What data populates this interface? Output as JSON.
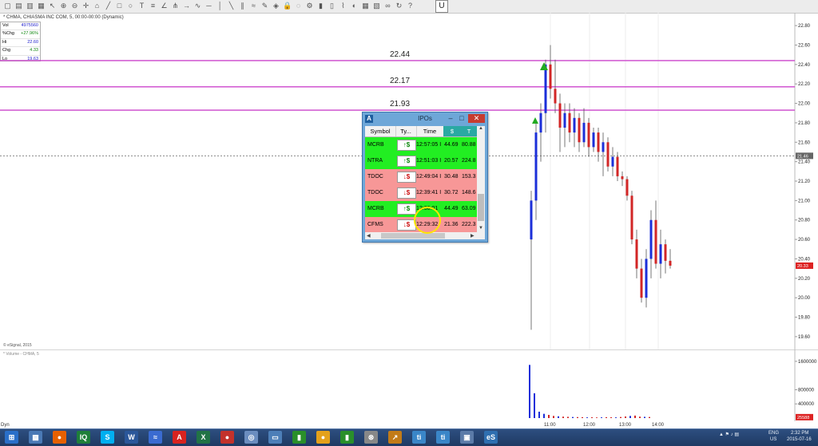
{
  "toolbar": {
    "icons": [
      "file-icon",
      "open-icon",
      "save-icon",
      "print-icon",
      "cursor-icon",
      "zoom-in-icon",
      "zoom-out-icon",
      "crosshair-icon",
      "home-icon",
      "line-icon",
      "rectangle-icon",
      "ellipse-icon",
      "text-icon",
      "fibonacci-icon",
      "gann-icon",
      "pitchfork-icon",
      "arrow-icon",
      "cycle-icon",
      "horizontal-line-icon",
      "vertical-line-icon",
      "trendline-icon",
      "channel-icon",
      "regression-icon",
      "erase-icon",
      "magnet-icon",
      "lock-icon",
      "hide-icon",
      "properties-icon",
      "bar-style-icon",
      "candle-icon",
      "line-style-icon",
      "color-icon",
      "layout-icon",
      "template-icon",
      "link-icon",
      "refresh-icon",
      "help-icon"
    ],
    "u_label": "U"
  },
  "chart": {
    "title": "* CHMA, CHIASMA INC COM, 5, 00:00-00:00 (Dynamic)",
    "info": [
      {
        "key": "Vol",
        "value": "4975560"
      },
      {
        "key": "%Chg",
        "value": "+27.96%",
        "color": "green"
      },
      {
        "key": "Hi",
        "value": "22.60"
      },
      {
        "key": "Chg",
        "value": "4.33",
        "color": "green"
      },
      {
        "key": "Lo",
        "value": "19.63"
      }
    ],
    "levels": [
      "22.44",
      "22.17",
      "21.93"
    ],
    "esignal": "© eSignal, 2015",
    "volume_label": "* Volume - CHMA, 5",
    "dyn": "Dyn",
    "price_badge": "21.46",
    "last_badge": "20.33",
    "vol_badge": "25588"
  },
  "chart_data": [
    {
      "type": "candlestick",
      "yaxis_ticks": [
        "22.80",
        "22.60",
        "22.40",
        "22.20",
        "22.00",
        "21.80",
        "21.60",
        "21.40",
        "21.20",
        "21.00",
        "20.80",
        "20.60",
        "20.40",
        "20.20",
        "20.00",
        "19.80",
        "19.60"
      ],
      "ylim": [
        19.55,
        22.85
      ],
      "xaxis_ticks": [
        "11:00",
        "12:00",
        "13:00",
        "14:00"
      ],
      "horizontal_lines": [
        22.44,
        22.17,
        21.93
      ],
      "dotted_line": 21.46,
      "candles": [
        {
          "o": 20.6,
          "h": 21.1,
          "l": 19.67,
          "c": 21.0
        },
        {
          "o": 21.0,
          "h": 21.8,
          "l": 20.8,
          "c": 21.7
        },
        {
          "o": 21.7,
          "h": 22.0,
          "l": 21.4,
          "c": 21.9
        },
        {
          "o": 21.9,
          "h": 22.45,
          "l": 21.7,
          "c": 22.4
        },
        {
          "o": 22.4,
          "h": 22.6,
          "l": 22.05,
          "c": 22.15
        },
        {
          "o": 22.15,
          "h": 22.45,
          "l": 21.9,
          "c": 22.0
        },
        {
          "o": 22.0,
          "h": 22.1,
          "l": 21.5,
          "c": 21.75
        },
        {
          "o": 21.75,
          "h": 22.0,
          "l": 21.55,
          "c": 21.9
        },
        {
          "o": 21.9,
          "h": 22.0,
          "l": 21.6,
          "c": 21.7
        },
        {
          "o": 21.7,
          "h": 21.95,
          "l": 21.55,
          "c": 21.85
        },
        {
          "o": 21.85,
          "h": 21.9,
          "l": 21.5,
          "c": 21.6
        },
        {
          "o": 21.6,
          "h": 21.95,
          "l": 21.55,
          "c": 21.8
        },
        {
          "o": 21.8,
          "h": 21.85,
          "l": 21.45,
          "c": 21.55
        },
        {
          "o": 21.55,
          "h": 21.75,
          "l": 21.5,
          "c": 21.7
        },
        {
          "o": 21.7,
          "h": 21.75,
          "l": 21.4,
          "c": 21.5
        },
        {
          "o": 21.5,
          "h": 21.7,
          "l": 21.25,
          "c": 21.6
        },
        {
          "o": 21.6,
          "h": 21.65,
          "l": 21.3,
          "c": 21.35
        },
        {
          "o": 21.35,
          "h": 21.55,
          "l": 21.25,
          "c": 21.45
        },
        {
          "o": 21.45,
          "h": 21.5,
          "l": 21.2,
          "c": 21.25
        },
        {
          "o": 21.25,
          "h": 21.3,
          "l": 21.15,
          "c": 21.22
        },
        {
          "o": 21.22,
          "h": 21.25,
          "l": 21.0,
          "c": 21.05
        },
        {
          "o": 21.05,
          "h": 21.1,
          "l": 20.55,
          "c": 20.6
        },
        {
          "o": 20.6,
          "h": 20.7,
          "l": 20.2,
          "c": 20.3
        },
        {
          "o": 20.3,
          "h": 20.4,
          "l": 19.95,
          "c": 20.0
        },
        {
          "o": 20.0,
          "h": 20.5,
          "l": 19.9,
          "c": 20.4
        },
        {
          "o": 20.4,
          "h": 20.9,
          "l": 20.2,
          "c": 20.8
        },
        {
          "o": 20.8,
          "h": 21.0,
          "l": 20.3,
          "c": 20.35
        },
        {
          "o": 20.35,
          "h": 20.7,
          "l": 20.2,
          "c": 20.55
        },
        {
          "o": 20.55,
          "h": 20.6,
          "l": 20.25,
          "c": 20.38
        },
        {
          "o": 20.38,
          "h": 20.5,
          "l": 20.3,
          "c": 20.33
        }
      ]
    },
    {
      "type": "bar",
      "yaxis_ticks": [
        "1600000",
        "800000",
        "400000"
      ],
      "values": [
        1500000,
        700000,
        180000,
        120000,
        90000,
        60000,
        50000,
        40000,
        35000,
        30000,
        28000,
        25000,
        20000,
        22000,
        18000,
        20000,
        25000,
        22000,
        20000,
        30000,
        45000,
        60000,
        70000,
        40000,
        35000,
        30000
      ]
    }
  ],
  "ipo_window": {
    "title": "IPOs",
    "app_letter": "A",
    "columns": [
      "Symbol",
      "Ty...",
      "Time",
      "$",
      "T"
    ],
    "rows": [
      {
        "symbol": "MCRB",
        "dir": "up",
        "badge": "↑$",
        "time": "12:57:05 I",
        "price": "44.69",
        "t": "80.88"
      },
      {
        "symbol": "NTRA",
        "dir": "up",
        "badge": "↑$",
        "time": "12:51:03 I",
        "price": "20.57",
        "t": "224.8"
      },
      {
        "symbol": "TDOC",
        "dir": "down",
        "badge": "↓$",
        "time": "12:49:04 I",
        "price": "30.48",
        "t": "153.3"
      },
      {
        "symbol": "TDOC",
        "dir": "down",
        "badge": "↓$",
        "time": "12:39:41 I",
        "price": "30.72",
        "t": "148.6"
      },
      {
        "symbol": "MCRB",
        "dir": "up",
        "badge": "↑$",
        "time": "12:36:01",
        "price": "44.49",
        "t": "63.09"
      },
      {
        "symbol": "CFMS",
        "dir": "down",
        "badge": "↓$",
        "time": "12:29:32",
        "price": "21.36",
        "t": "222.3"
      }
    ]
  },
  "taskbar": {
    "apps": [
      {
        "name": "start-button",
        "label": "⊞",
        "color": "#2a6fc9"
      },
      {
        "name": "file-explorer-icon",
        "label": "▦",
        "color": "#4a79b5"
      },
      {
        "name": "firefox-icon",
        "label": "●",
        "color": "#e66000"
      },
      {
        "name": "iq-icon",
        "label": "IQ",
        "color": "#1e7f3a"
      },
      {
        "name": "skype-icon",
        "label": "S",
        "color": "#00aff0"
      },
      {
        "name": "word-icon",
        "label": "W",
        "color": "#2b579a"
      },
      {
        "name": "stock-chart-icon",
        "label": "≈",
        "color": "#3a6bd1"
      },
      {
        "name": "pdf-icon",
        "label": "A",
        "color": "#d8231f"
      },
      {
        "name": "excel-icon",
        "label": "X",
        "color": "#217346"
      },
      {
        "name": "browser-icon",
        "label": "●",
        "color": "#c3322b"
      },
      {
        "name": "media-icon",
        "label": "◎",
        "color": "#6b8dbf"
      },
      {
        "name": "monitor-icon",
        "label": "▭",
        "color": "#4d7fb8"
      },
      {
        "name": "trading-icon",
        "label": "▮",
        "color": "#2a8f2a"
      },
      {
        "name": "chrome-icon",
        "label": "●",
        "color": "#e4a11b"
      },
      {
        "name": "trading-icon-2",
        "label": "▮",
        "color": "#2a8f2a"
      },
      {
        "name": "steering-icon",
        "label": "⊗",
        "color": "#888888"
      },
      {
        "name": "arrow-app-icon",
        "label": "↗",
        "color": "#c27b18"
      },
      {
        "name": "ti-icon",
        "label": "ti",
        "color": "#3a86c8"
      },
      {
        "name": "ti-icon-2",
        "label": "ti",
        "color": "#3a86c8"
      },
      {
        "name": "network-icon",
        "label": "▣",
        "color": "#5b7ba8"
      },
      {
        "name": "esignal-icon",
        "label": "eS",
        "color": "#2f6fb0"
      }
    ],
    "lang": "ENG",
    "region": "US",
    "time": "2:32 PM",
    "date": "2015-07-16"
  }
}
